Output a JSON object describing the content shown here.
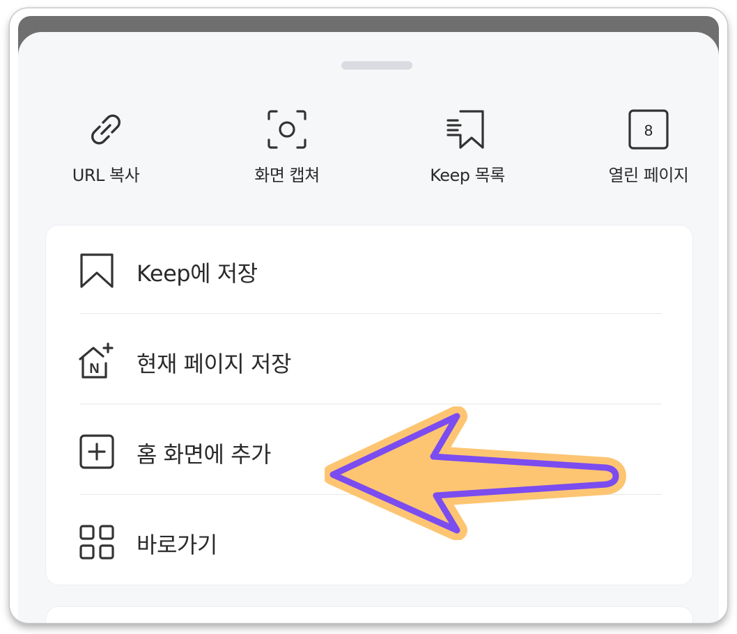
{
  "quick_actions": [
    {
      "label": "URL 복사",
      "icon": "link-icon"
    },
    {
      "label": "화면 캡쳐",
      "icon": "screen-capture-icon"
    },
    {
      "label": "Keep 목록",
      "icon": "keep-list-icon"
    },
    {
      "label": "열린 페이지",
      "icon": "open-pages-icon",
      "badge": "8"
    }
  ],
  "menu": [
    {
      "label": "Keep에 저장",
      "icon": "bookmark-icon"
    },
    {
      "label": "현재 페이지 저장",
      "icon": "naver-home-add-icon",
      "icon_letter": "N"
    },
    {
      "label": "홈 화면에 추가",
      "icon": "add-square-icon"
    },
    {
      "label": "바로가기",
      "icon": "grid-icon"
    }
  ],
  "colors": {
    "sheet_bg": "#f6f7f9",
    "card_bg": "#ffffff",
    "text": "#2a2a2a",
    "icon_stroke": "#333333",
    "arrow_fill": "#fdc572",
    "arrow_outline": "#7b4cf0"
  }
}
